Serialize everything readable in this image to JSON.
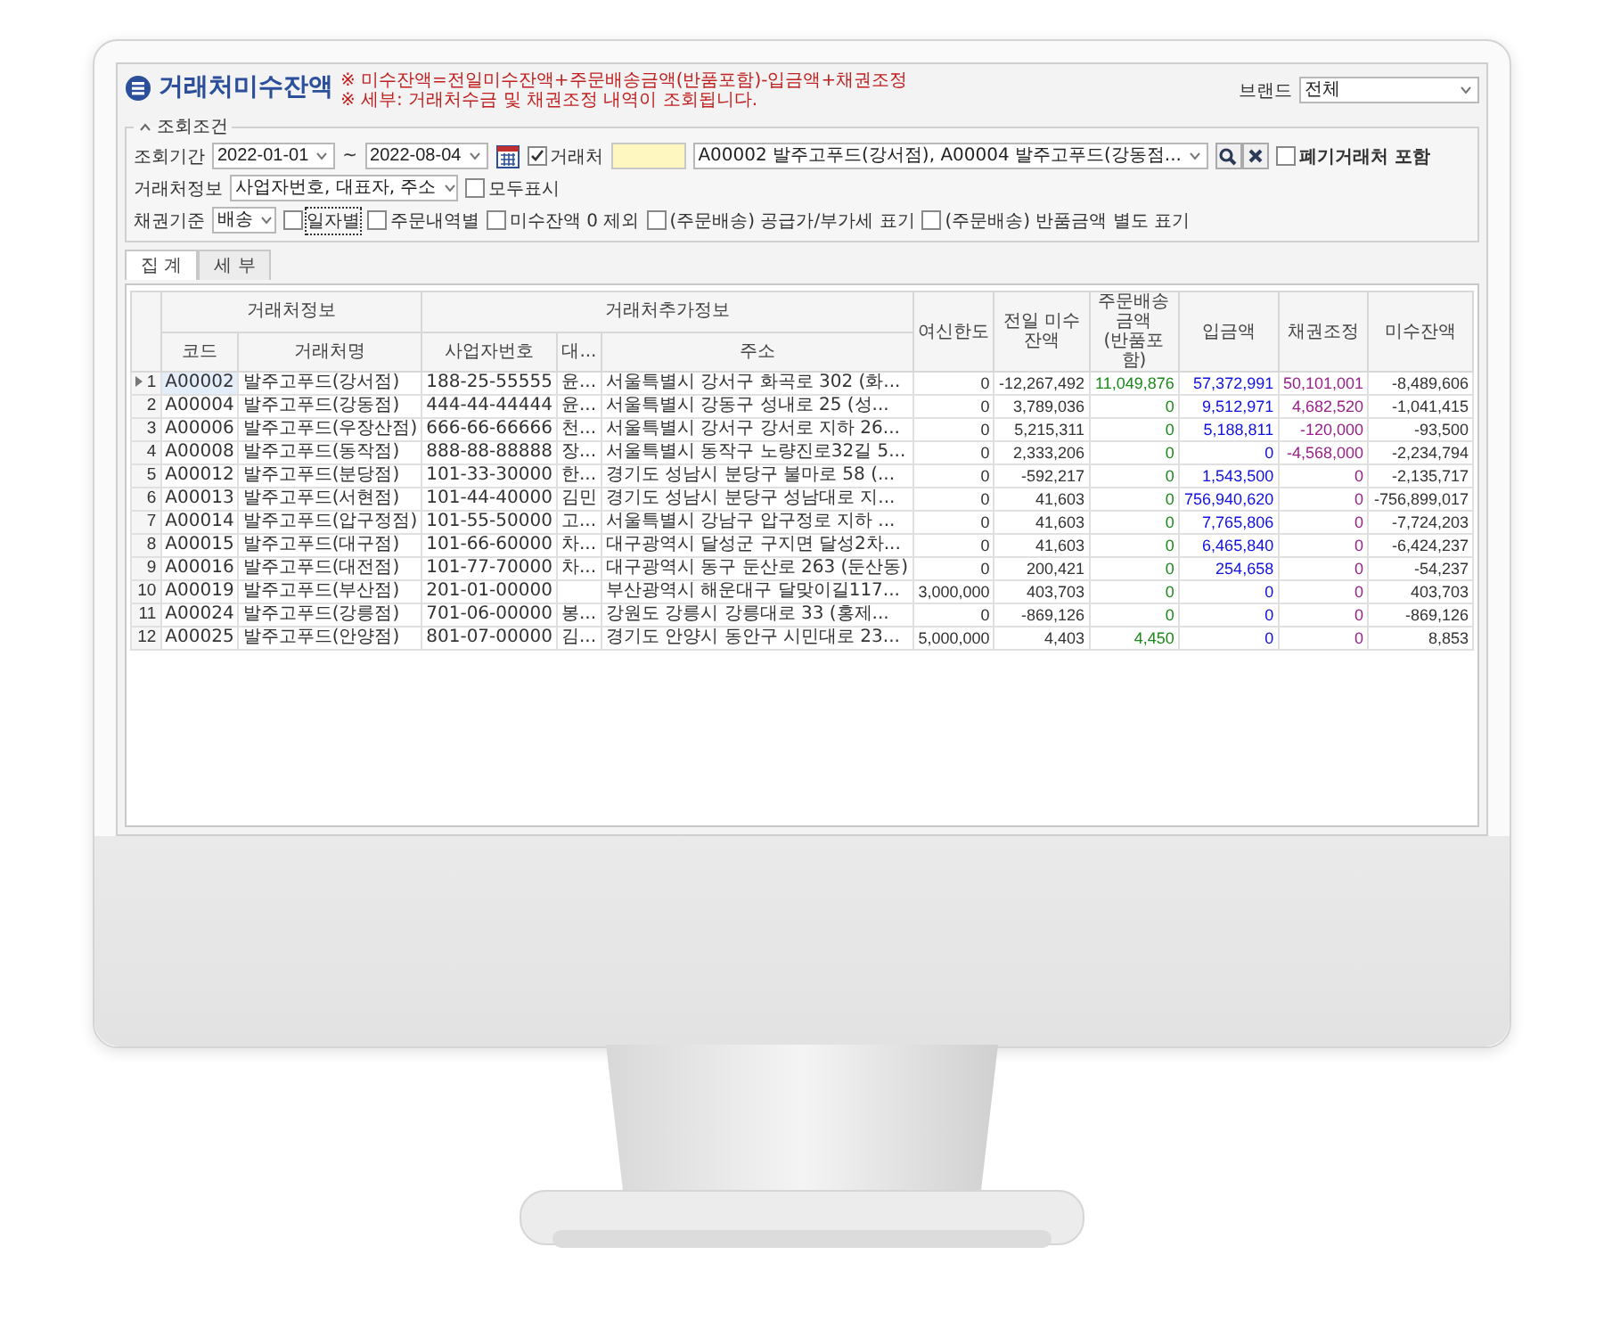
{
  "window": {
    "title": "거래처미수잔액",
    "notes": [
      "※ 미수잔액=전일미수잔액+주문배송금액(반품포함)-입금액+채권조정",
      "※ 세부: 거래처수금 및 채권조정 내역이 조회됩니다."
    ]
  },
  "brand": {
    "label": "브랜드",
    "value": "전체"
  },
  "conditions": {
    "title": "조회조건",
    "period_label": "조회기간",
    "date_from": "2022-01-01",
    "separator": "~",
    "date_to": "2022-08-04",
    "client": {
      "label": "거래처",
      "checked": true,
      "value": "A00002 발주고푸드(강서점), A00004 발주고푸드(강동점..."
    },
    "include_closed": {
      "label": "폐기거래처 포함",
      "checked": false
    },
    "client_info": {
      "label": "거래처정보",
      "value": "사업자번호, 대표자, 주소"
    },
    "show_all": {
      "label": "모두표시",
      "checked": false
    },
    "basis": {
      "label": "채권기준",
      "value": "배송"
    },
    "options": [
      {
        "label": "일자별",
        "checked": false,
        "focused": true
      },
      {
        "label": "주문내역별",
        "checked": false,
        "focused": false
      },
      {
        "label": "미수잔액 0 제외",
        "checked": false,
        "focused": false
      },
      {
        "label": "(주문배송) 공급가/부가세 표기",
        "checked": false,
        "focused": false
      },
      {
        "label": "(주문배송) 반품금액 별도 표기",
        "checked": false,
        "focused": false
      }
    ]
  },
  "tabs": [
    {
      "label": "집 계",
      "selected": true
    },
    {
      "label": "세 부",
      "selected": false
    }
  ],
  "table": {
    "header_groups": [
      {
        "label": "거래처정보",
        "columns": [
          {
            "label": "코드"
          },
          {
            "label": "거래처명"
          }
        ]
      },
      {
        "label": "거래처추가정보",
        "columns": [
          {
            "label": "사업자번호"
          },
          {
            "label": "대..."
          },
          {
            "label": "주소"
          }
        ]
      },
      {
        "columns": [
          {
            "label": "여신한도"
          }
        ]
      },
      {
        "columns": [
          {
            "label": "전일 미수잔액"
          }
        ]
      },
      {
        "columns": [
          {
            "label": "주문배송금액",
            "sub": "(반품포함)"
          }
        ]
      },
      {
        "columns": [
          {
            "label": "입금액"
          }
        ]
      },
      {
        "columns": [
          {
            "label": "채권조정"
          }
        ]
      },
      {
        "columns": [
          {
            "label": "미수잔액"
          }
        ]
      }
    ],
    "rows": [
      {
        "no": "1",
        "selected": true,
        "cells": [
          "A00002",
          "발주고푸드(강서점)",
          "188-25-55555",
          "윤...",
          "서울특별시 강서구 화곡로 302 (화...",
          "0",
          "-12,267,492",
          "11,049,876",
          "57,372,991",
          "50,101,001",
          "-8,489,606"
        ]
      },
      {
        "no": "2",
        "selected": false,
        "cells": [
          "A00004",
          "발주고푸드(강동점)",
          "444-44-44444",
          "윤...",
          "서울특별시 강동구 성내로 25 (성...",
          "0",
          "3,789,036",
          "0",
          "9,512,971",
          "4,682,520",
          "-1,041,415"
        ]
      },
      {
        "no": "3",
        "selected": false,
        "cells": [
          "A00006",
          "발주고푸드(우장산점)",
          "666-66-66666",
          "천...",
          "서울특별시 강서구 강서로 지하 26...",
          "0",
          "5,215,311",
          "0",
          "5,188,811",
          "-120,000",
          "-93,500"
        ]
      },
      {
        "no": "4",
        "selected": false,
        "cells": [
          "A00008",
          "발주고푸드(동작점)",
          "888-88-88888",
          "장...",
          "서울특별시 동작구 노량진로32길 5...",
          "0",
          "2,333,206",
          "0",
          "0",
          "-4,568,000",
          "-2,234,794"
        ]
      },
      {
        "no": "5",
        "selected": false,
        "cells": [
          "A00012",
          "발주고푸드(분당점)",
          "101-33-30000",
          "한...",
          "경기도 성남시 분당구 불마로 58 (...",
          "0",
          "-592,217",
          "0",
          "1,543,500",
          "0",
          "-2,135,717"
        ]
      },
      {
        "no": "6",
        "selected": false,
        "cells": [
          "A00013",
          "발주고푸드(서현점)",
          "101-44-40000",
          "김민",
          "경기도 성남시 분당구 성남대로 지...",
          "0",
          "41,603",
          "0",
          "756,940,620",
          "0",
          "-756,899,017"
        ]
      },
      {
        "no": "7",
        "selected": false,
        "cells": [
          "A00014",
          "발주고푸드(압구정점)",
          "101-55-50000",
          "고...",
          "서울특별시 강남구 압구정로 지하 ...",
          "0",
          "41,603",
          "0",
          "7,765,806",
          "0",
          "-7,724,203"
        ]
      },
      {
        "no": "8",
        "selected": false,
        "cells": [
          "A00015",
          "발주고푸드(대구점)",
          "101-66-60000",
          "차...",
          "대구광역시 달성군 구지면 달성2차...",
          "0",
          "41,603",
          "0",
          "6,465,840",
          "0",
          "-6,424,237"
        ]
      },
      {
        "no": "9",
        "selected": false,
        "cells": [
          "A00016",
          "발주고푸드(대전점)",
          "101-77-70000",
          "차...",
          "대구광역시 동구 둔산로 263 (둔산동)",
          "0",
          "200,421",
          "0",
          "254,658",
          "0",
          "-54,237"
        ]
      },
      {
        "no": "10",
        "selected": false,
        "cells": [
          "A00019",
          "발주고푸드(부산점)",
          "201-01-00000",
          null,
          "부산광역시 해운대구 달맞이길117...",
          "3,000,000",
          "403,703",
          "0",
          "0",
          "0",
          "403,703"
        ]
      },
      {
        "no": "11",
        "selected": false,
        "cells": [
          "A00024",
          "발주고푸드(강릉점)",
          "701-06-00000",
          "봉...",
          "강원도 강릉시 강릉대로 33 (홍제...",
          "0",
          "-869,126",
          "0",
          "0",
          "0",
          "-869,126"
        ]
      },
      {
        "no": "12",
        "selected": false,
        "cells": [
          "A00025",
          "발주고푸드(안양점)",
          "801-07-00000",
          "김...",
          "경기도 안양시 동안구 시민대로 23...",
          "5,000,000",
          "4,403",
          "4,450",
          "0",
          "0",
          "8,853"
        ]
      }
    ]
  }
}
